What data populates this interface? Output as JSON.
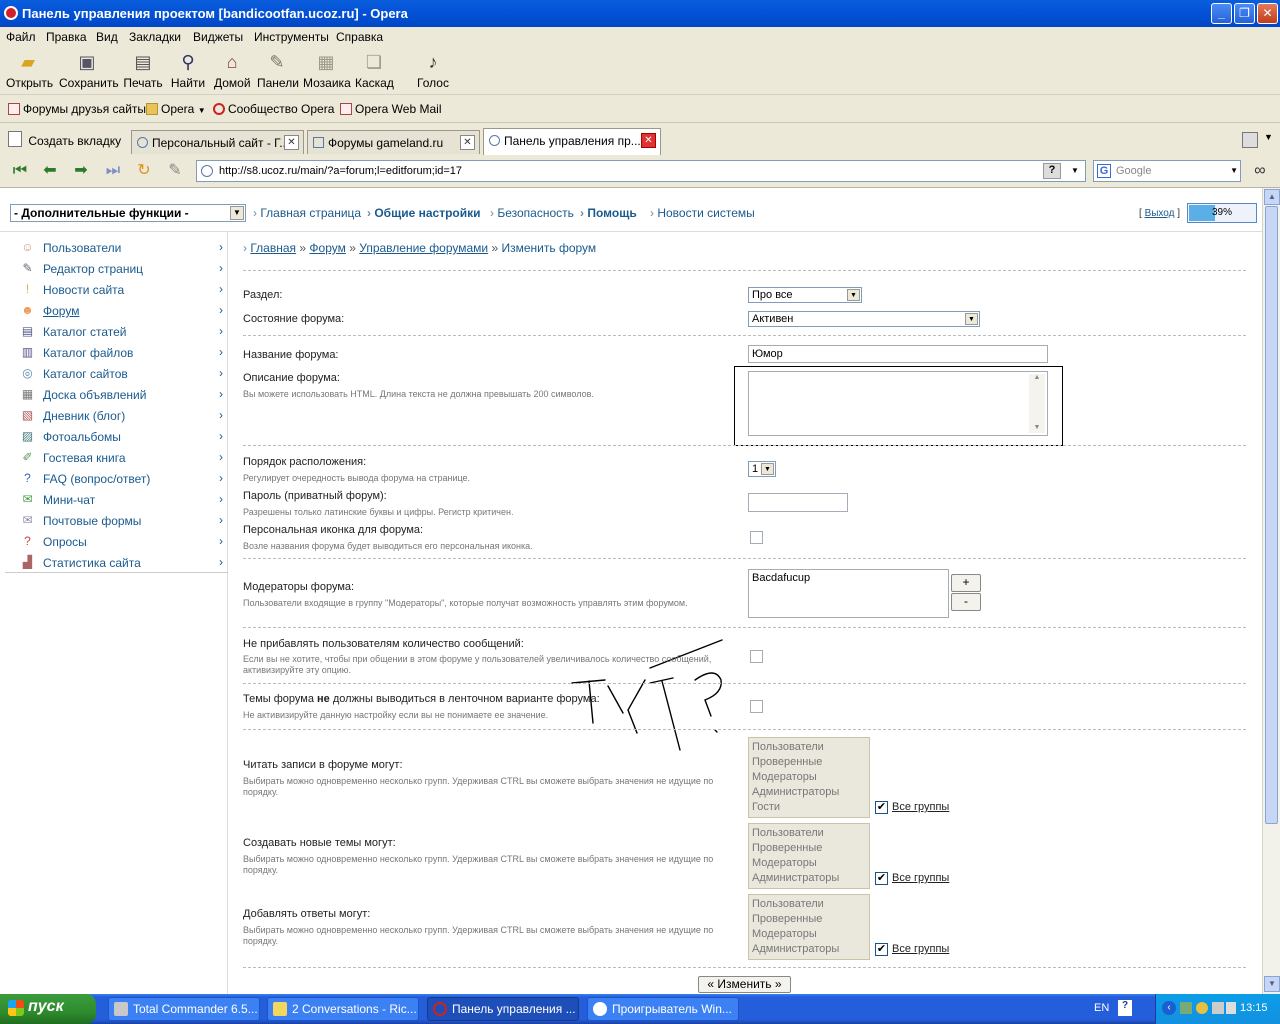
{
  "window": {
    "title": "Панель управления проектом [bandicootfan.ucoz.ru] - Opera"
  },
  "menu": [
    "Файл",
    "Правка",
    "Вид",
    "Закладки",
    "Виджеты",
    "Инструменты",
    "Справка"
  ],
  "toolbar": [
    {
      "label": "Открыть",
      "icon": "folder-icon"
    },
    {
      "label": "Сохранить",
      "icon": "floppy-icon"
    },
    {
      "label": "Печать",
      "icon": "printer-icon"
    },
    {
      "label": "Найти",
      "icon": "magnifier-icon"
    },
    {
      "label": "Домой",
      "icon": "home-icon"
    },
    {
      "label": "Панели",
      "icon": "panels-icon"
    },
    {
      "label": "Мозаика",
      "icon": "tile-icon"
    },
    {
      "label": "Каскад",
      "icon": "cascade-icon"
    },
    {
      "label": "Голос",
      "icon": "microphone-icon"
    }
  ],
  "bookmarks": [
    "Форумы друзья сайты",
    "Opera",
    "Сообщество Opera",
    "Opera Web Mail"
  ],
  "tabs": {
    "new_tab": "Создать вкладку",
    "items": [
      "Персональный сайт - Г...",
      "Форумы gameland.ru",
      "Панель управления пр..."
    ]
  },
  "address": {
    "url": "http://s8.ucoz.ru/main/?a=forum;l=editforum;id=17",
    "search_placeholder": "Google"
  },
  "topnav": {
    "extra": "- Дополнительные функции -",
    "links": [
      "Главная страница",
      "Общие настройки",
      "Безопасность",
      "Помощь",
      "Новости системы"
    ],
    "exit": "Выход",
    "progress": "39%",
    "progress_value": 39
  },
  "sidebar": [
    "Пользователи",
    "Редактор страниц",
    "Новости сайта",
    "Форум",
    "Каталог статей",
    "Каталог файлов",
    "Каталог сайтов",
    "Доска объявлений",
    "Дневник (блог)",
    "Фотоальбомы",
    "Гостевая книга",
    "FAQ (вопрос/ответ)",
    "Мини-чат",
    "Почтовые формы",
    "Опросы",
    "Статистика сайта"
  ],
  "breadcrumb": {
    "home": "Главная",
    "forum": "Форум",
    "manage": "Управление форумами",
    "current": "Изменить форум"
  },
  "form": {
    "section_label": "Раздел:",
    "section_value": "Про все",
    "state_label": "Состояние форума:",
    "state_value": "Активен",
    "name_label": "Название форума:",
    "name_value": "Юмор",
    "desc_label": "Описание форума:",
    "desc_hint": "Вы можете использовать HTML. Длина текста не должна превышать 200 символов.",
    "order_label": "Порядок расположения:",
    "order_hint": "Регулирует очередность вывода форума на странице.",
    "order_value": "1",
    "pass_label": "Пароль (приватный форум):",
    "pass_hint": "Разрешены только латинские буквы и цифры. Регистр критичен.",
    "icon_label": "Персональная иконка для форума:",
    "icon_hint": "Возле названия форума будет выводиться его персональная иконка.",
    "mods_label": "Модераторы форума:",
    "mods_hint": "Пользователи входящие в группу \"Модераторы\", которые получат возможность управлять этим форумом.",
    "mods_value": "Bacdafucup",
    "add_btn": "+",
    "rem_btn": "-",
    "nocount_label": "Не прибавлять пользователям количество сообщений:",
    "nocount_hint": "Если вы не хотите, чтобы при общении в этом форуме у пользователей увеличивалось количество сообщений, активизируйте эту опцию.",
    "feed_label_a": "Темы форума",
    "feed_label_b": "не",
    "feed_label_c": "должны выводиться в ленточном варианте форума:",
    "feed_hint": "Не активизируйте данную настройку если вы не понимаете ее значение.",
    "read_label": "Читать записи в форуме могут:",
    "groups_hint": "Выбирать можно одновременно несколько групп. Удерживая CTRL вы сможете выбрать значения не идущие по порядку.",
    "read_groups": [
      "Пользователи",
      "Проверенные",
      "Модераторы",
      "Администраторы",
      "Гости"
    ],
    "create_label": "Создавать новые темы могут:",
    "create_groups": [
      "Пользователи",
      "Проверенные",
      "Модераторы",
      "Администраторы"
    ],
    "reply_label": "Добавлять ответы могут:",
    "reply_groups": [
      "Пользователи",
      "Проверенные",
      "Модераторы",
      "Администраторы"
    ],
    "all_groups": "Все группы",
    "submit": "« Изменить »"
  },
  "taskbar": {
    "start": "пуск",
    "tasks": [
      "Total Commander 6.5...",
      "2 Conversations - Ric...",
      "Панель управления ...",
      "Проигрыватель Win..."
    ],
    "lang": "EN",
    "time": "13:15"
  }
}
